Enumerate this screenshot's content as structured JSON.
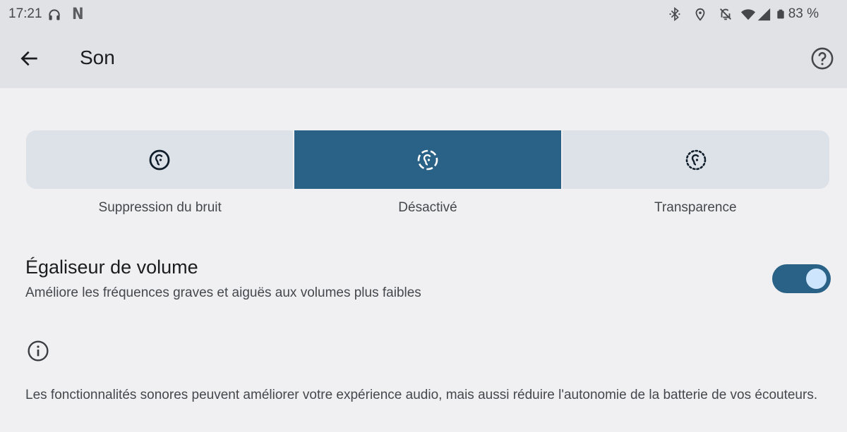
{
  "status_bar": {
    "time": "17:21",
    "left_icons": [
      "headphones-icon",
      "netflix-icon"
    ],
    "netflix_glyph": "N",
    "right_icons": [
      "bluetooth-icon",
      "location-icon",
      "notifications-off-icon",
      "wifi-icon",
      "cell-signal-icon",
      "battery-icon"
    ],
    "battery_percent": "83 %"
  },
  "app_bar": {
    "title": "Son",
    "back_icon": "arrow-back-icon",
    "help_icon": "help-icon"
  },
  "noise_control": {
    "options": [
      {
        "label": "Suppression du bruit",
        "icon": "noise-cancellation-icon",
        "selected": false
      },
      {
        "label": "Désactivé",
        "icon": "noise-control-off-icon",
        "selected": true
      },
      {
        "label": "Transparence",
        "icon": "transparency-icon",
        "selected": false
      }
    ]
  },
  "volume_eq": {
    "title": "Égaliseur de volume",
    "subtitle": "Améliore les fréquences graves et aiguës aux volumes plus faibles",
    "enabled": true
  },
  "info": {
    "icon": "info-icon",
    "text": "Les fonctionnalités sonores peuvent améliorer votre expérience audio, mais aussi réduire l'autonomie de la batterie de vos écouteurs."
  },
  "colors": {
    "accent": "#2a6186",
    "segment_bg": "#dde1e8",
    "toggle_thumb": "#cde5fd",
    "page_bg": "#f0f0f3",
    "bar_bg": "#e1e2e5"
  }
}
